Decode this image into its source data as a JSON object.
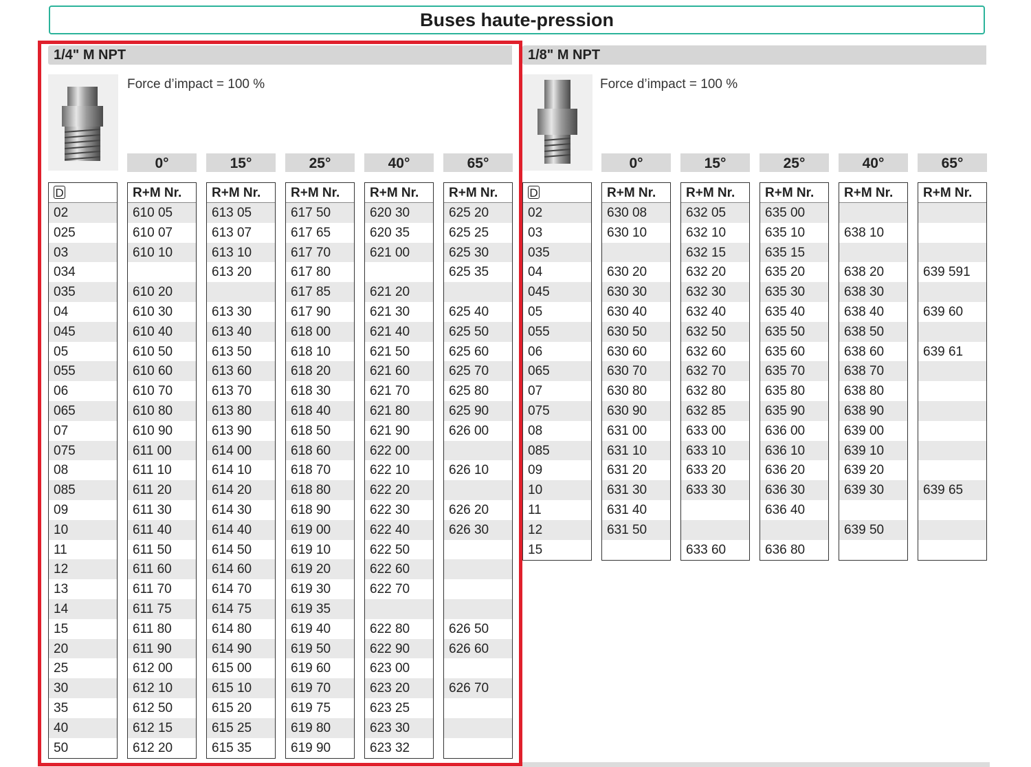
{
  "title": "Buses haute-pression",
  "sections": [
    {
      "heading": "1/4\" M NPT",
      "force": "Force d’impact = 100 %",
      "diam_header": "D",
      "col_header": "R+M Nr.",
      "angles": [
        "0°",
        "15°",
        "25°",
        "40°",
        "65°"
      ],
      "rows": [
        "02",
        "025",
        "03",
        "034",
        "035",
        "04",
        "045",
        "05",
        "055",
        "06",
        "065",
        "07",
        "075",
        "08",
        "085",
        "09",
        "10",
        "11",
        "12",
        "13",
        "14",
        "15",
        "20",
        "25",
        "30",
        "35",
        "40",
        "50"
      ],
      "columns": [
        [
          "610 05",
          "610 07",
          "610 10",
          "",
          "610 20",
          "610 30",
          "610 40",
          "610 50",
          "610 60",
          "610 70",
          "610 80",
          "610 90",
          "611 00",
          "611 10",
          "611 20",
          "611 30",
          "611 40",
          "611 50",
          "611 60",
          "611 70",
          "611 75",
          "611 80",
          "611 90",
          "612 00",
          "612 10",
          "612 50",
          "612 15",
          "612 20"
        ],
        [
          "613 05",
          "613 07",
          "613 10",
          "613 20",
          "",
          "613 30",
          "613 40",
          "613 50",
          "613 60",
          "613 70",
          "613 80",
          "613 90",
          "614 00",
          "614 10",
          "614 20",
          "614 30",
          "614 40",
          "614 50",
          "614 60",
          "614 70",
          "614 75",
          "614 80",
          "614 90",
          "615 00",
          "615 10",
          "615 20",
          "615 25",
          "615 35"
        ],
        [
          "617 50",
          "617 65",
          "617 70",
          "617 80",
          "617 85",
          "617 90",
          "618 00",
          "618 10",
          "618 20",
          "618 30",
          "618 40",
          "618 50",
          "618 60",
          "618 70",
          "618 80",
          "618 90",
          "619 00",
          "619 10",
          "619 20",
          "619 30",
          "619 35",
          "619 40",
          "619 50",
          "619 60",
          "619 70",
          "619 75",
          "619 80",
          "619 90"
        ],
        [
          "620 30",
          "620 35",
          "621 00",
          "",
          "621 20",
          "621 30",
          "621 40",
          "621 50",
          "621 60",
          "621 70",
          "621 80",
          "621 90",
          "622 00",
          "622 10",
          "622 20",
          "622 30",
          "622 40",
          "622 50",
          "622 60",
          "622 70",
          "",
          "622 80",
          "622 90",
          "623 00",
          "623 20",
          "623 25",
          "623 30",
          "623 32"
        ],
        [
          "625 20",
          "625 25",
          "625 30",
          "625 35",
          "",
          "625 40",
          "625 50",
          "625 60",
          "625 70",
          "625 80",
          "625 90",
          "626 00",
          "",
          "626 10",
          "",
          "626 20",
          "626 30",
          "",
          "",
          "",
          "",
          "626 50",
          "626 60",
          "",
          "626 70",
          "",
          "",
          ""
        ]
      ]
    },
    {
      "heading": "1/8\" M NPT",
      "force": "Force d’impact = 100 %",
      "diam_header": "D",
      "col_header": "R+M Nr.",
      "angles": [
        "0°",
        "15°",
        "25°",
        "40°",
        "65°"
      ],
      "rows": [
        "02",
        "03",
        "035",
        "04",
        "045",
        "05",
        "055",
        "06",
        "065",
        "07",
        "075",
        "08",
        "085",
        "09",
        "10",
        "11",
        "12",
        "15"
      ],
      "columns": [
        [
          "630 08",
          "630 10",
          "",
          "630 20",
          "630 30",
          "630 40",
          "630 50",
          "630 60",
          "630 70",
          "630 80",
          "630 90",
          "631 00",
          "631 10",
          "631 20",
          "631 30",
          "631 40",
          "631 50",
          ""
        ],
        [
          "632 05",
          "632 10",
          "632 15",
          "632 20",
          "632 30",
          "632 40",
          "632 50",
          "632 60",
          "632 70",
          "632 80",
          "632 85",
          "633 00",
          "633 10",
          "633 20",
          "633 30",
          "",
          "",
          "633 60"
        ],
        [
          "635 00",
          "635 10",
          "635 15",
          "635 20",
          "635 30",
          "635 40",
          "635 50",
          "635 60",
          "635 70",
          "635 80",
          "635 90",
          "636 00",
          "636 10",
          "636 20",
          "636 30",
          "636 40",
          "",
          "636 80"
        ],
        [
          "",
          "638 10",
          "",
          "638 20",
          "638 30",
          "638 40",
          "638 50",
          "638 60",
          "638 70",
          "638 80",
          "638 90",
          "639 00",
          "639 10",
          "639 20",
          "639 30",
          "",
          "639 50",
          ""
        ],
        [
          "",
          "",
          "",
          "639 591",
          "",
          "639 60",
          "",
          "639 61",
          "",
          "",
          "",
          "",
          "",
          "",
          "639 65",
          "",
          "",
          ""
        ]
      ]
    }
  ]
}
